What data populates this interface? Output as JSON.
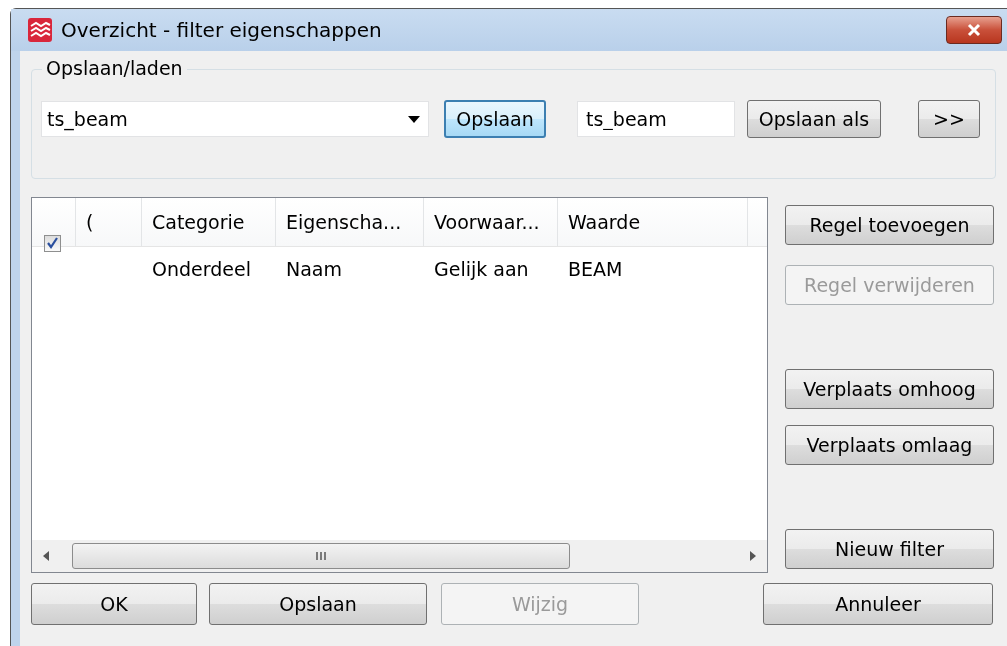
{
  "window": {
    "title": "Overzicht - filter eigenschappen"
  },
  "save_load": {
    "legend": "Opslaan/laden",
    "filter_dropdown": {
      "value": "ts_beam"
    },
    "save_button": {
      "label": "Opslaan",
      "focused": true
    },
    "name_field": {
      "value": "ts_beam"
    },
    "save_as_button": {
      "label": "Opslaan als"
    },
    "more_button": {
      "label": ">>"
    }
  },
  "table": {
    "columns": [
      "(",
      "Categorie",
      "Eigenscha...",
      "Voorwaar...",
      "Waarde"
    ],
    "rows": [
      {
        "checked": true,
        "cells": [
          null,
          "Onderdeel",
          "Naam",
          "Gelijk aan",
          "BEAM"
        ]
      }
    ]
  },
  "side_buttons": [
    [
      {
        "label": "Regel toevoegen",
        "disabled": false
      },
      {
        "label": "Regel verwijderen",
        "disabled": true
      }
    ],
    [
      {
        "label": "Verplaats omhoog",
        "disabled": false
      },
      {
        "label": "Verplaats omlaag",
        "disabled": false
      }
    ],
    [
      {
        "label": "Nieuw filter",
        "disabled": false
      }
    ]
  ],
  "bottom_buttons": [
    {
      "label": "OK",
      "disabled": false
    },
    {
      "label": "Opslaan",
      "disabled": false
    },
    {
      "label": "Wijzig",
      "disabled": true
    },
    {
      "label": "Annuleer",
      "disabled": false
    }
  ]
}
